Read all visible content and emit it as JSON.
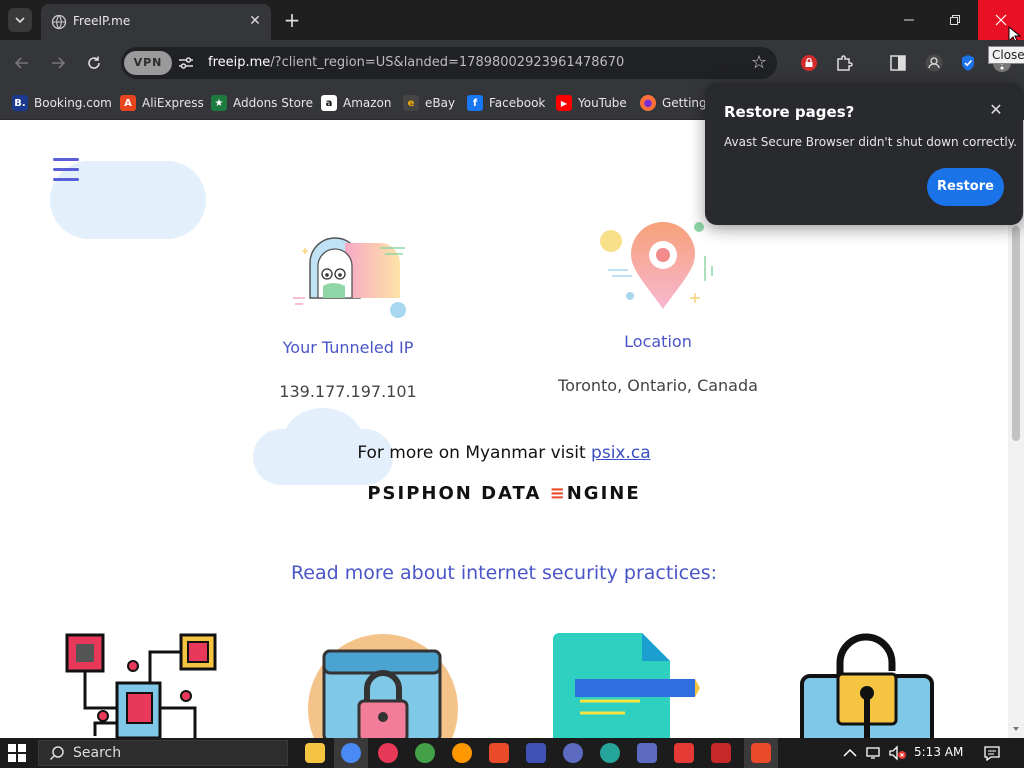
{
  "browser": {
    "tab": {
      "title": "FreeIP.me"
    },
    "toolbar": {
      "vpn_label": "VPN",
      "url_host": "freeip.me",
      "url_rest": "/?client_region=US&landed=17898002923961478670"
    },
    "bookmarks": [
      {
        "label": "Booking.com",
        "color": "#1b3a8f",
        "glyph": "B."
      },
      {
        "label": "AliExpress",
        "color": "#e8451e",
        "glyph": "A"
      },
      {
        "label": "Addons Store",
        "color": "#1f7a3f",
        "glyph": "★"
      },
      {
        "label": "Amazon",
        "color": "#ffffff",
        "glyph": "a"
      },
      {
        "label": "eBay",
        "color": "#444444",
        "glyph": "e"
      },
      {
        "label": "Facebook",
        "color": "#1877f2",
        "glyph": "f"
      },
      {
        "label": "YouTube",
        "color": "#ff0000",
        "glyph": "▶"
      },
      {
        "label": "Getting",
        "color": "#ff7139",
        "glyph": "●"
      }
    ],
    "tooltip": "Close"
  },
  "restore_popup": {
    "title": "Restore pages?",
    "message": "Avast Secure Browser didn't shut down correctly.",
    "button_label": "Restore"
  },
  "page": {
    "tunneled_ip_label": "Your Tunneled IP",
    "tunneled_ip_value": "139.177.197.101",
    "location_label": "Location",
    "location_value": "Toronto, Ontario, Canada",
    "visit_prefix": "For more on Myanmar visit ",
    "visit_link": "psix.ca",
    "engine_part1": "PSIPHON DATA ",
    "engine_E": "≡",
    "engine_part2": "NGINE",
    "read_more": "Read more about internet security practices:"
  },
  "taskbar": {
    "search_placeholder": "Search",
    "time": "5:13 AM"
  },
  "colors": {
    "accent_blue": "#4a56c8",
    "restore_button": "#1a73e8",
    "close_red": "#e81123"
  }
}
